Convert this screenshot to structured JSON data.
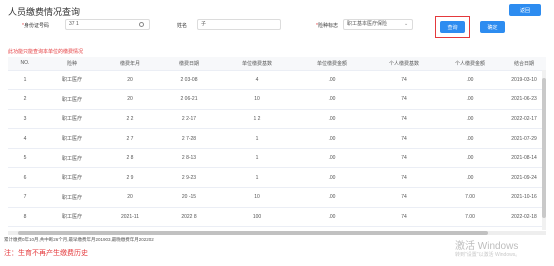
{
  "page": {
    "title": "人员缴费情况查询",
    "back_label": "返回"
  },
  "form": {
    "id_label": "身份证号码",
    "id_value": "37                           1",
    "name_label": "姓名",
    "name_value": "       子",
    "insurance_label": "险种标志",
    "insurance_value": "职工基本医疗保险",
    "query_label": "查询",
    "confirm_label": "确定"
  },
  "note_top": "此功能只能查询本单位的缴费情况",
  "table": {
    "columns": [
      "NO.",
      "险种",
      "缴费年月",
      "缴费日期",
      "单位缴费基数",
      "单位缴费金额",
      "个人缴费基数",
      "个人缴费金额",
      "结合日期"
    ],
    "rows": [
      [
        "1",
        "职工医疗",
        "20    ",
        "2       03-08",
        "4",
        "           .00",
        "              74",
        "           .00",
        "2019-03-10"
      ],
      [
        "2",
        "职工医疗",
        "20    ",
        "2       06-21",
        "10      ",
        "           .00",
        "              74",
        "           .00",
        "2021-06-23"
      ],
      [
        "3",
        "职工医疗",
        "2     2",
        "2        2-17",
        "1     2",
        "           .00",
        "              74",
        "           .00",
        "2022-02-17"
      ],
      [
        "4",
        "职工医疗",
        "2     7",
        "2        7-28",
        "1       ",
        "           .00",
        "              74",
        "           .00",
        "2021-07-29"
      ],
      [
        "5",
        "职工医疗",
        "2     8",
        "2        8-13",
        "1       ",
        "           .00",
        "              74",
        "           .00",
        "2021-08-14"
      ],
      [
        "6",
        "职工医疗",
        "2     9",
        "2        9-23",
        "1       ",
        "           .00",
        "              74",
        "           .00",
        "2021-09-24"
      ],
      [
        "7",
        "职工医疗",
        "20     ",
        "20       -15",
        "10      ",
        "           .00",
        "              74",
        "          7.00",
        "2021-10-16"
      ],
      [
        "8",
        "职工医疗",
        "2021-11",
        "2022     8",
        "100    ",
        "           .00",
        "              74",
        "          7.00",
        "2022-02-18"
      ]
    ]
  },
  "summary": "累计缴费0年10月,共中断26个月,最早缴费年月201903,最晚缴费年月202202",
  "bottom_note": "注：生育不再产生缴费历史",
  "watermark": {
    "title": "激活 Windows",
    "subtitle": "转到\"设置\"以激活 Windows。"
  }
}
